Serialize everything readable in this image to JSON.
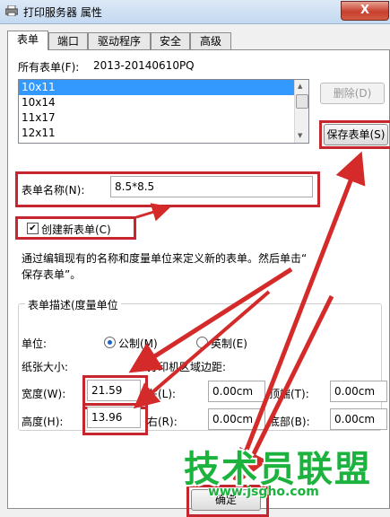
{
  "window": {
    "title": "打印服务器 属性",
    "close_label": "X"
  },
  "tabs": [
    {
      "label": "表单"
    },
    {
      "label": "端口"
    },
    {
      "label": "驱动程序"
    },
    {
      "label": "安全"
    },
    {
      "label": "高级"
    }
  ],
  "forms": {
    "label": "所有表单(F):",
    "computer_name": "2013-20140610PQ",
    "items": [
      "10x11",
      "10x14",
      "11x17",
      "12x11"
    ],
    "selected_index": 0
  },
  "buttons": {
    "delete": "删除(D)",
    "save_form": "保存表单(S)",
    "ok": "确定"
  },
  "form_name": {
    "label": "表单名称(N):",
    "value": "8.5*8.5"
  },
  "create_new": {
    "label": "创建新表单(C)",
    "checked": true
  },
  "description": {
    "line1": "通过编辑现有的名称和度量单位来定义新的表单。然后单击“",
    "line2": "保存表单”。"
  },
  "group": {
    "title": "表单描述(度量单位",
    "units_label": "单位:",
    "metric_label": "公制(M)",
    "english_label": "英制(E)",
    "paper_size_label": "纸张大小:",
    "margins_label": "打印机区域边距:",
    "width_label": "宽度(W):",
    "width_value": "21.59",
    "height_label": "高度(H):",
    "height_value": "13.96",
    "left_label": "左(L):",
    "left_value": "0.00cm",
    "right_label": "右(R):",
    "right_value": "0.00cm",
    "top_label": "顶端(T):",
    "top_value": "0.00cm",
    "bottom_label": "底部(B):",
    "bottom_value": "0.00cm"
  },
  "watermark": {
    "text": "技术员联盟",
    "url": "www.jsgho.com"
  },
  "colors": {
    "highlight": "#c6262e",
    "selection": "#3399ff",
    "watermark": "#1bb33d"
  }
}
